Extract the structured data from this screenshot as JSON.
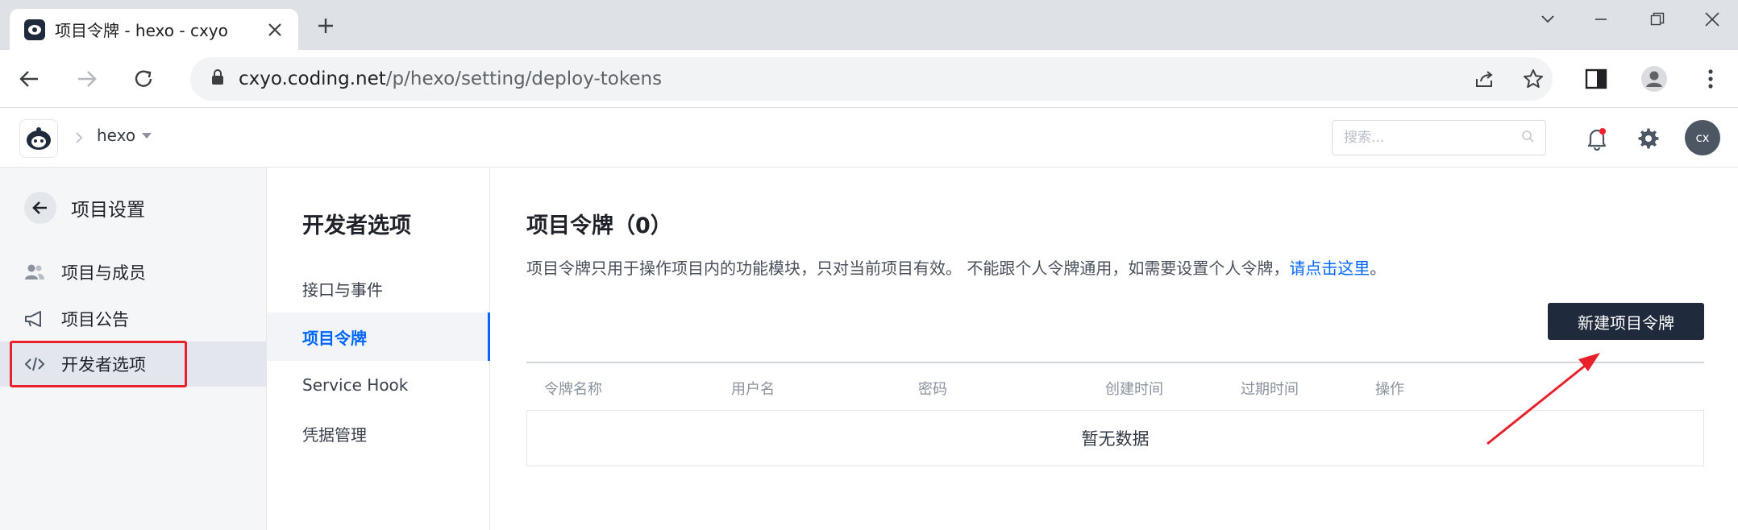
{
  "browser": {
    "tab_title": "项目令牌 - hexo - cxyo",
    "url_host": "cxyo.coding.net",
    "url_path": "/p/hexo/setting/deploy-tokens"
  },
  "header": {
    "project_name": "hexo",
    "search_placeholder": "搜索...",
    "avatar_initials": "cx"
  },
  "sidebar": {
    "title": "项目设置",
    "items": [
      {
        "label": "项目与成员",
        "icon": "users-icon"
      },
      {
        "label": "项目公告",
        "icon": "megaphone-icon"
      },
      {
        "label": "开发者选项",
        "icon": "code-icon",
        "active": true
      }
    ]
  },
  "subnav": {
    "title": "开发者选项",
    "items": [
      {
        "label": "接口与事件"
      },
      {
        "label": "项目令牌",
        "active": true
      },
      {
        "label": "Service Hook"
      },
      {
        "label": "凭据管理"
      }
    ]
  },
  "main": {
    "title": "项目令牌（0）",
    "description": "项目令牌只用于操作项目内的功能模块，只对当前项目有效。 不能跟个人令牌通用，如需要设置个人令牌，",
    "description_link": "请点击这里",
    "description_end": "。",
    "create_button": "新建项目令牌",
    "table_columns": [
      "令牌名称",
      "用户名",
      "密码",
      "创建时间",
      "过期时间",
      "操作"
    ],
    "empty_text": "暂无数据"
  },
  "colors": {
    "annotation_red": "#e8202a",
    "primary_blue": "#0066ff",
    "dark_button": "#1f2a3c"
  }
}
